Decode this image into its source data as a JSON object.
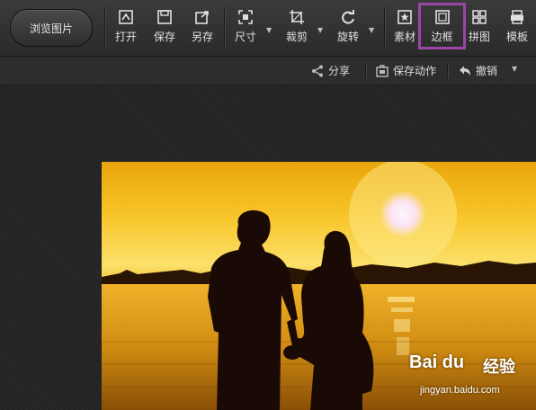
{
  "toolbar": {
    "browse_label": "浏览图片",
    "tools": [
      {
        "label": "打开",
        "icon": "open-icon"
      },
      {
        "label": "保存",
        "icon": "save-icon"
      },
      {
        "label": "另存",
        "icon": "save-as-icon"
      },
      {
        "label": "尺寸",
        "icon": "resize-icon"
      },
      {
        "label": "裁剪",
        "icon": "crop-icon"
      },
      {
        "label": "旋转",
        "icon": "rotate-icon"
      },
      {
        "label": "素材",
        "icon": "sticker-icon"
      },
      {
        "label": "边框",
        "icon": "frame-icon"
      },
      {
        "label": "拼图",
        "icon": "collage-icon"
      },
      {
        "label": "模板",
        "icon": "template-icon"
      }
    ]
  },
  "subbar": {
    "share_label": "分享",
    "save_action_label": "保存动作",
    "undo_label": "撤销"
  },
  "watermark": {
    "logo_text": "Bai du",
    "brand_text": "经验",
    "url_text": "jingyan.baidu.com"
  },
  "colors": {
    "highlight": "#9b45a8",
    "toolbar_bg": "#333333",
    "canvas_bg": "#232323"
  }
}
